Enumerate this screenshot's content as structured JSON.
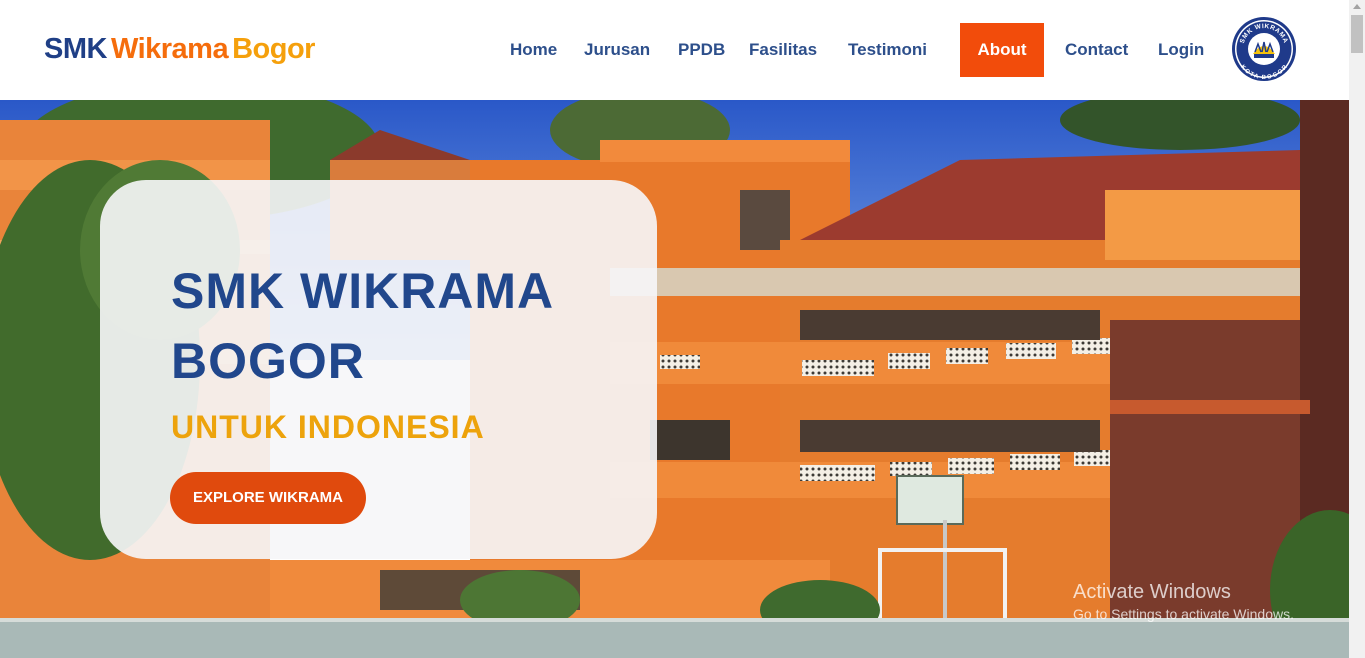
{
  "brand": {
    "part1": "SMK",
    "part2": "Wikrama",
    "part3": "Bogor"
  },
  "nav": {
    "items": [
      {
        "label": "Home",
        "active": false
      },
      {
        "label": "Jurusan",
        "active": false
      },
      {
        "label": "PPDB",
        "active": false
      },
      {
        "label": "Fasilitas",
        "active": false
      },
      {
        "label": "Testimoni",
        "active": false
      },
      {
        "label": "About",
        "active": true
      },
      {
        "label": "Contact",
        "active": false
      },
      {
        "label": "Login",
        "active": false
      }
    ]
  },
  "seal": {
    "top_text": "SMK WIKRAMA",
    "bottom_text": "KOTA BOGOR"
  },
  "hero": {
    "title_line1": "SMK WIKRAMA",
    "title_line2": "BOGOR",
    "subtitle": "UNTUK INDONESIA",
    "cta_label": "EXPLORE WIKRAMA"
  },
  "watermark": {
    "line1": "Activate Windows",
    "line2": "Go to Settings to activate Windows."
  },
  "colors": {
    "navy": "#21478c",
    "orange": "#f56d0c",
    "amber": "#f5a00c",
    "active_nav": "#f24c0b",
    "cta": "#e04a0d"
  }
}
